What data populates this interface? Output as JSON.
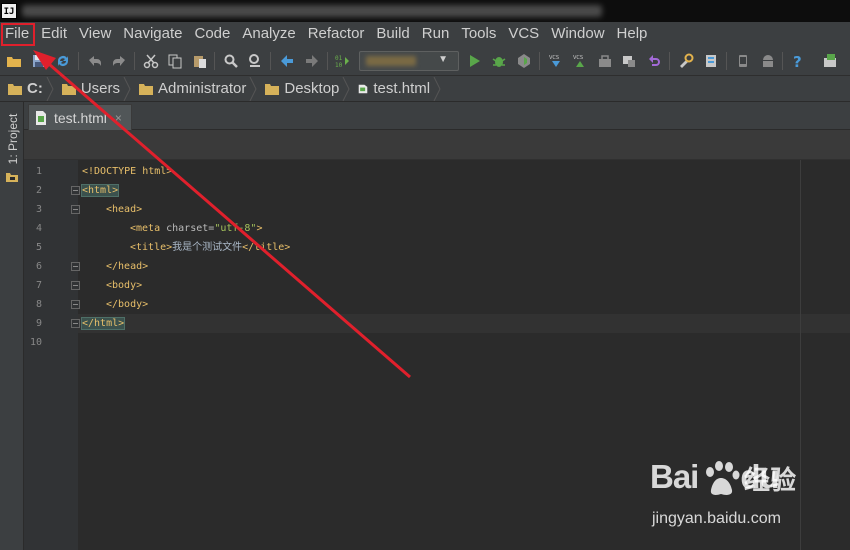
{
  "titlebar": {
    "logo_text": "IJ"
  },
  "menu": [
    "File",
    "Edit",
    "View",
    "Navigate",
    "Code",
    "Analyze",
    "Refactor",
    "Build",
    "Run",
    "Tools",
    "VCS",
    "Window",
    "Help"
  ],
  "toolbar": {
    "icons": [
      "open-folder-icon",
      "save-icon",
      "sync-icon",
      "undo-icon",
      "redo-icon",
      "cut-icon",
      "copy-icon",
      "paste-icon",
      "find-icon",
      "replace-icon",
      "back-icon",
      "forward-icon",
      "make-project-icon",
      "run-icon",
      "debug-icon",
      "coverage-icon",
      "vcs-update-icon",
      "vcs-commit-icon",
      "vcs-compare-icon",
      "vcs-history-icon",
      "vcs-revert-icon",
      "settings-icon",
      "project-structure-icon",
      "avd-manager-icon",
      "android-sdk-icon",
      "help-icon",
      "terminal-icon"
    ]
  },
  "breadcrumb": [
    "C:",
    "Users",
    "Administrator",
    "Desktop",
    "test.html"
  ],
  "toolstrip": {
    "project_tab": "1: Project"
  },
  "editor_tab": {
    "label": "test.html",
    "close": "×"
  },
  "editor": {
    "line_numbers": [
      "1",
      "2",
      "3",
      "4",
      "5",
      "6",
      "7",
      "8",
      "9",
      "10"
    ],
    "code": {
      "l1": "<!DOCTYPE html>",
      "l2": "<html>",
      "l3": "<head>",
      "l4_open": "<meta ",
      "l4_attr": "charset",
      "l4_eq": "=",
      "l4_val": "\"utf-8\"",
      "l4_close": ">",
      "l5_open": "<title>",
      "l5_text": "我是个测试文件",
      "l5_close": "</title>",
      "l6": "</head>",
      "l7": "<body>",
      "l8": "</body>",
      "l9": "</html>"
    }
  },
  "annotation": {
    "color": "#e0202c"
  },
  "watermark": {
    "logo": "Bai",
    "logo_tail": "du",
    "brand": "经验",
    "url": "jingyan.baidu.com"
  },
  "colors": {
    "menubar": "#3c3f41",
    "editor_bg": "#2b2b2b",
    "tag": "#e8bf6a",
    "string": "#a5c25c"
  }
}
